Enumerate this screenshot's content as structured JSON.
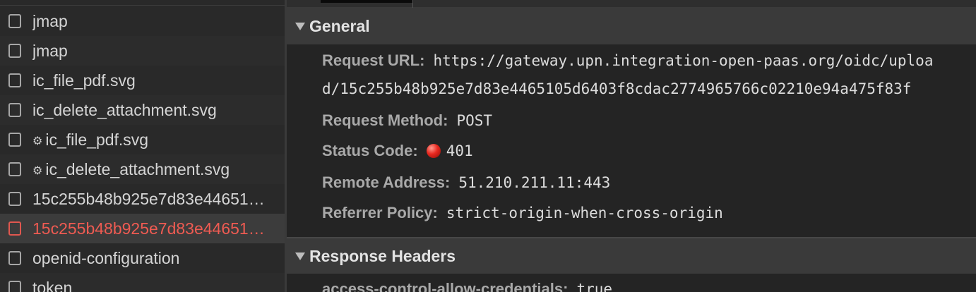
{
  "requests": [
    {
      "name": "jmap",
      "gear": false,
      "error": false
    },
    {
      "name": "jmap",
      "gear": false,
      "error": false
    },
    {
      "name": "ic_file_pdf.svg",
      "gear": false,
      "error": false
    },
    {
      "name": "ic_delete_attachment.svg",
      "gear": false,
      "error": false
    },
    {
      "name": "ic_file_pdf.svg",
      "gear": true,
      "error": false
    },
    {
      "name": "ic_delete_attachment.svg",
      "gear": true,
      "error": false
    },
    {
      "name": "15c255b48b925e7d83e44651…",
      "gear": false,
      "error": false
    },
    {
      "name": "15c255b48b925e7d83e44651…",
      "gear": false,
      "error": true
    },
    {
      "name": "openid-configuration",
      "gear": false,
      "error": false
    },
    {
      "name": "token",
      "gear": false,
      "error": false
    }
  ],
  "general": {
    "title": "General",
    "request_url_label": "Request URL:",
    "request_url_line1": "https://gateway.upn.integration-open-paas.org/oidc/uploa",
    "request_url_line2": "d/15c255b48b925e7d83e4465105d6403f8cdac2774965766c02210e94a475f83f",
    "request_method_label": "Request Method:",
    "request_method": "POST",
    "status_code_label": "Status Code:",
    "status_code": "401",
    "status_color": "#e8281f",
    "remote_address_label": "Remote Address:",
    "remote_address": "51.210.211.11:443",
    "referrer_policy_label": "Referrer Policy:",
    "referrer_policy": "strict-origin-when-cross-origin"
  },
  "response_headers": {
    "title": "Response Headers",
    "first_header_name": "access-control-allow-credentials:",
    "first_header_value": "true"
  }
}
